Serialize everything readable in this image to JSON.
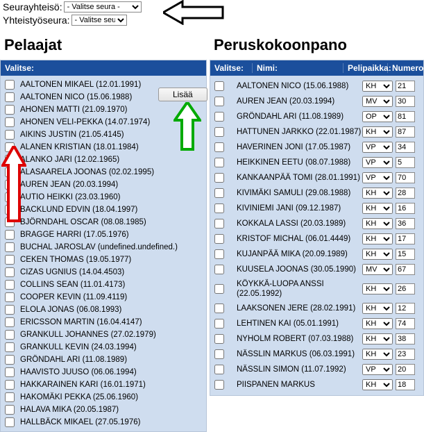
{
  "top": {
    "seurayhteiso_label": "Seurayhteisö:",
    "yhteistyoseura_label": "Yhteistyöseura:",
    "select_placeholder": "- Valitse seura -"
  },
  "left": {
    "heading": "Pelaajat",
    "header_valitse": "Valitse:",
    "add_button": "Lisää",
    "players": [
      "AALTONEN MIKAEL (12.01.1991)",
      "AALTONEN NICO (15.06.1988)",
      "AHONEN MATTI (21.09.1970)",
      "AHONEN VELI-PEKKA (14.07.1974)",
      "AIKINS JUSTIN (21.05.4145)",
      "ALANEN KRISTIAN (18.01.1984)",
      "ALANKO JARI (12.02.1965)",
      "ALASAARELA JOONAS (02.02.1995)",
      "AUREN JEAN (20.03.1994)",
      "AUTIO HEIKKI (23.03.1960)",
      "BACKLUND EDVIN (18.04.1997)",
      "BJÖRNDAHL OSCAR (08.08.1985)",
      "BRAGGE HARRI (17.05.1976)",
      "BUCHAL JAROSLAV (undefined.undefined.)",
      "CEKEN THOMAS (19.05.1977)",
      "CIZAS UGNIUS (14.04.4503)",
      "COLLINS SEAN (11.01.4173)",
      "COOPER KEVIN (11.09.4119)",
      "ELOLA JONAS (06.08.1993)",
      "ERICSSON MARTIN (16.04.4147)",
      "GRANKULL JOHANNES (27.02.1979)",
      "GRANKULL KEVIN (24.03.1994)",
      "GRÖNDAHL ARI (11.08.1989)",
      "HAAVISTO JUUSO (06.06.1994)",
      "HAKKARAINEN KARI (16.01.1971)",
      "HAKOMÄKI PEKKA (25.06.1960)",
      "HALAVA MIKA (20.05.1987)",
      "HALLBÄCK MIKAEL (27.05.1976)"
    ]
  },
  "right": {
    "heading": "Peruskokoonpano",
    "header_valitse": "Valitse:",
    "header_nimi": "Nimi:",
    "header_pelipaikka": "Pelipaikka:",
    "header_numero": "Numero:",
    "roster": [
      {
        "name": "AALTONEN NICO (15.06.1988)",
        "pos": "KH",
        "num": "21"
      },
      {
        "name": "AUREN JEAN (20.03.1994)",
        "pos": "MV",
        "num": "30"
      },
      {
        "name": "GRÖNDAHL ARI (11.08.1989)",
        "pos": "OP",
        "num": "81"
      },
      {
        "name": "HATTUNEN JARKKO (22.01.1987)",
        "pos": "KH",
        "num": "87"
      },
      {
        "name": "HAVERINEN JONI (17.05.1987)",
        "pos": "VP",
        "num": "34"
      },
      {
        "name": "HEIKKINEN EETU (08.07.1988)",
        "pos": "VP",
        "num": "5"
      },
      {
        "name": "KANKAANPÄÄ TOMI (28.01.1991)",
        "pos": "VP",
        "num": "70"
      },
      {
        "name": "KIVIMÄKI SAMULI (29.08.1988)",
        "pos": "KH",
        "num": "28"
      },
      {
        "name": "KIVINIEMI JANI (09.12.1987)",
        "pos": "KH",
        "num": "16"
      },
      {
        "name": "KOKKALA LASSI (20.03.1989)",
        "pos": "KH",
        "num": "36"
      },
      {
        "name": "KRISTOF MICHAL (06.01.4449)",
        "pos": "KH",
        "num": "17"
      },
      {
        "name": "KUJANPÄÄ MIKA (20.09.1989)",
        "pos": "KH",
        "num": "15"
      },
      {
        "name": "KUUSELA JOONAS (30.05.1990)",
        "pos": "MV",
        "num": "67"
      },
      {
        "name": "KÖYKKÄ-LUOPA ANSSI (22.05.1992)",
        "pos": "KH",
        "num": "26"
      },
      {
        "name": "LAAKSONEN JERE (28.02.1991)",
        "pos": "KH",
        "num": "12"
      },
      {
        "name": "LEHTINEN KAI (05.01.1991)",
        "pos": "KH",
        "num": "74"
      },
      {
        "name": "NYHOLM ROBERT (07.03.1988)",
        "pos": "KH",
        "num": "38"
      },
      {
        "name": "NÄSSLIN MARKUS (06.03.1991)",
        "pos": "KH",
        "num": "23"
      },
      {
        "name": "NÄSSLIN SIMON (11.07.1992)",
        "pos": "VP",
        "num": "20"
      },
      {
        "name": "PIISPANEN MARKUS",
        "pos": "KH",
        "num": "18"
      }
    ]
  }
}
